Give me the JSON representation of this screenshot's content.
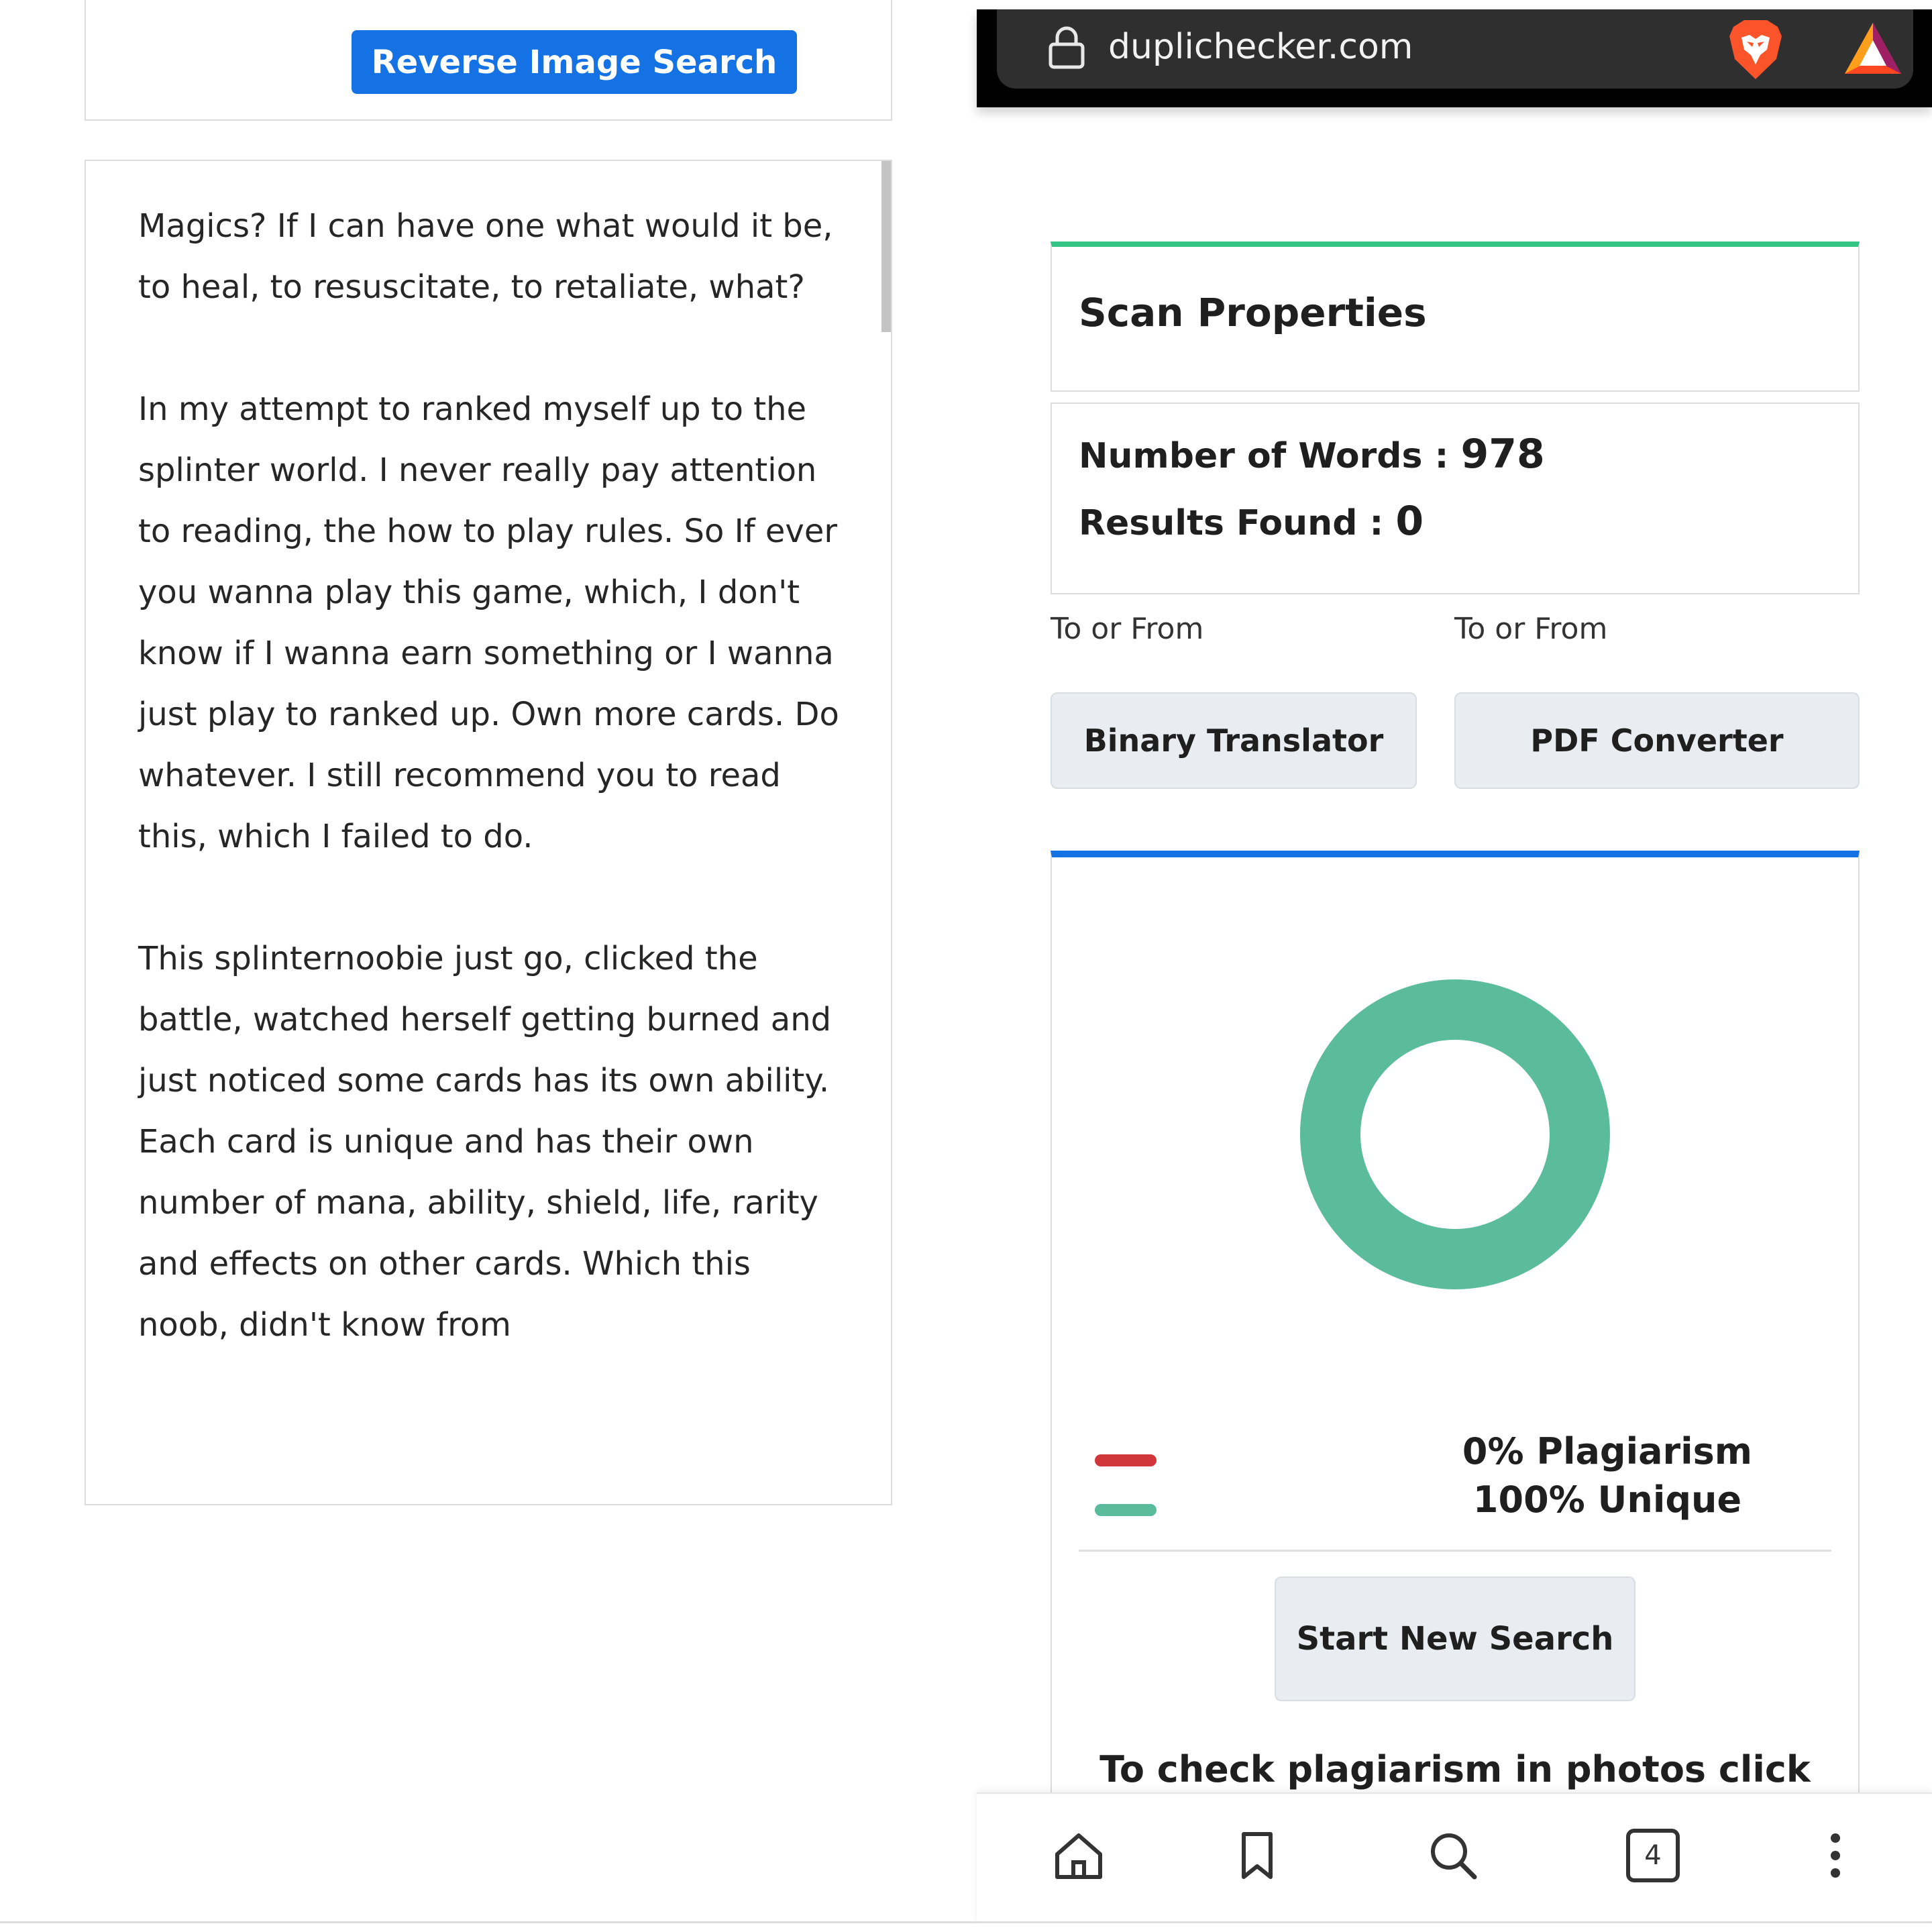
{
  "left": {
    "reverse_button": "Reverse Image Search",
    "paragraphs": [
      "Magics? If I can have one what would it be, to heal, to resuscitate, to retaliate, what?",
      "In my attempt to ranked myself up to the splinter world. I never really pay attention to reading, the how to play rules. So If ever you wanna play this game, which, I don't know if I wanna earn something or I wanna just play to ranked up. Own more cards. Do whatever. I still recommend you to read this, which I failed to do.",
      "This splinternoobie just go, clicked the battle, watched herself getting burned and just noticed some cards has its own ability. Each card is unique and has their own number of mana, ability, shield, life, rarity and effects on other cards. Which this noob, didn't know from"
    ]
  },
  "browser": {
    "url": "duplichecker.com",
    "tab_count": "4",
    "icons": [
      "lock-icon",
      "brave-icon",
      "bat-icon",
      "home-icon",
      "bookmark-icon",
      "search-icon",
      "tabs-icon",
      "more-icon"
    ]
  },
  "scan": {
    "title": "Scan Properties",
    "words_label": "Number of Words : ",
    "words_value": "978",
    "results_label": "Results Found : ",
    "results_value": "0"
  },
  "tools": [
    {
      "caption": "To or From",
      "button": "Binary Translator"
    },
    {
      "caption": "To or From",
      "button": "PDF Converter"
    }
  ],
  "result": {
    "plagiarism_text": "0% Plagiarism",
    "unique_text": "100% Unique",
    "plagiarism_percent": 0,
    "unique_percent": 100,
    "plagiarism_color": "#d0363a",
    "unique_color": "#5bbc9c",
    "new_search_button": "Start New Search",
    "photo_note": "To check plagiarism in photos click"
  },
  "colors": {
    "primary_blue": "#1572e5",
    "scan_green": "#34c483"
  }
}
